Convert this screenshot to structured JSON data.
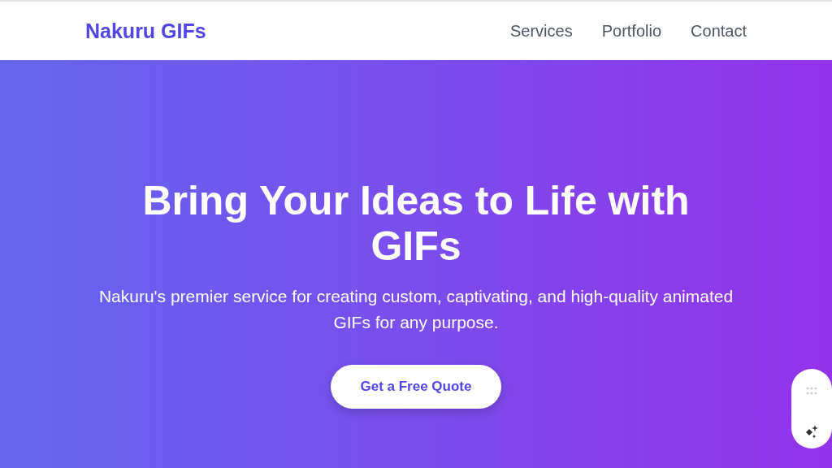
{
  "header": {
    "logo": "Nakuru GIFs",
    "nav": [
      {
        "label": "Services"
      },
      {
        "label": "Portfolio"
      },
      {
        "label": "Contact"
      }
    ]
  },
  "hero": {
    "title": "Bring Your Ideas to Life with GIFs",
    "subtitle": "Nakuru's premier service for creating custom, captivating, and high-quality animated GIFs for any purpose.",
    "button": "Get a Free Quote"
  }
}
